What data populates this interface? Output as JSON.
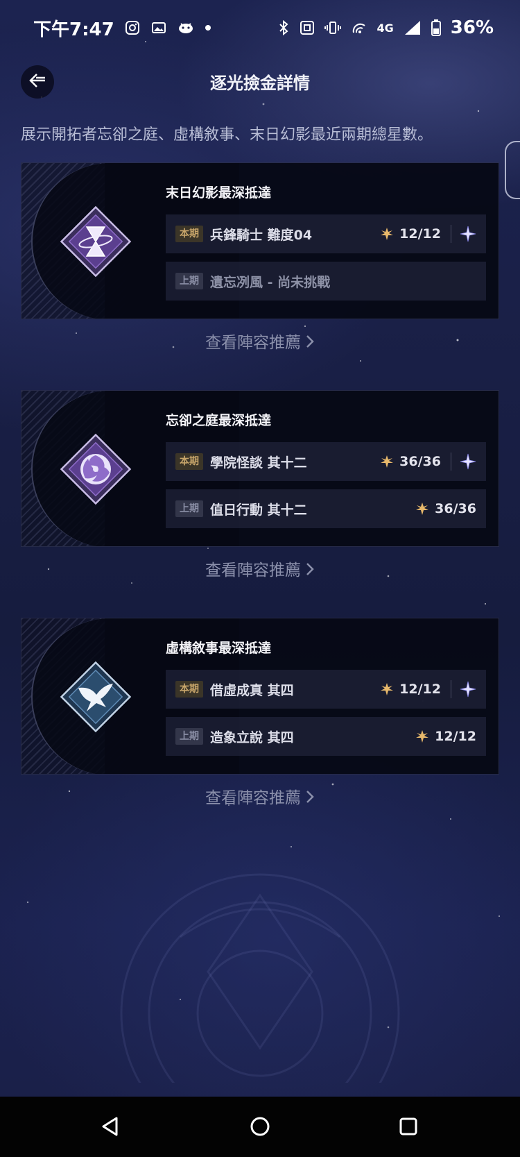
{
  "status_bar": {
    "time": "下午7:47",
    "network": "4G",
    "battery": "36%"
  },
  "header": {
    "title": "逐光撿金詳情",
    "back_icon": "back-arrow-icon"
  },
  "description": "展示開拓者忘卻之庭、虛構敘事、末日幻影最近兩期總星數。",
  "colors": {
    "gold_star": "#e7b86b",
    "current_badge_bg": "#3b3528",
    "previous_badge_bg": "#33364a",
    "accent_purple": "#8e6cc9"
  },
  "cards": [
    {
      "title": "末日幻影最深抵達",
      "emblem_icon": "hourglass-emblem-icon",
      "current": {
        "badge": "本期",
        "name": "兵鋒騎士 難度04",
        "score": "12/12",
        "special": true
      },
      "previous": {
        "badge": "上期",
        "name": "遺忘冽風 - 尚未挑戰",
        "score": ""
      },
      "link": "查看陣容推薦"
    },
    {
      "title": "忘卻之庭最深抵達",
      "emblem_icon": "swirl-emblem-icon",
      "current": {
        "badge": "本期",
        "name": "學院怪談 其十二",
        "score": "36/36",
        "special": true
      },
      "previous": {
        "badge": "上期",
        "name": "值日行動 其十二",
        "score": "36/36"
      },
      "link": "查看陣容推薦"
    },
    {
      "title": "虛構敘事最深抵達",
      "emblem_icon": "bird-emblem-icon",
      "current": {
        "badge": "本期",
        "name": "借虛成真 其四",
        "score": "12/12",
        "special": true
      },
      "previous": {
        "badge": "上期",
        "name": "造象立說 其四",
        "score": "12/12"
      },
      "link": "查看陣容推薦"
    }
  ]
}
